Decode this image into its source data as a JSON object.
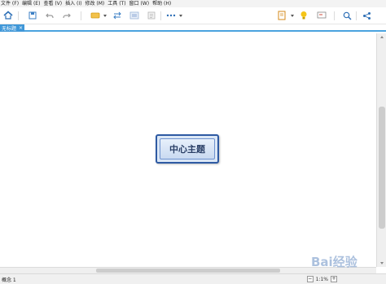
{
  "menu": [
    "文件 (F)",
    "编辑 (E)",
    "查看 (V)",
    "插入 (I)",
    "修改 (M)",
    "工具 (T)",
    "窗口 (W)",
    "帮助 (H)"
  ],
  "tab": {
    "label": "无标题",
    "close": "×"
  },
  "topic": {
    "label": "中心主题"
  },
  "status": {
    "label": "概念 1",
    "zoom": "1:1%",
    "zoom_out": "−",
    "zoom_in": "+"
  },
  "watermark": {
    "text": "Bai经验"
  },
  "colors": {
    "accent": "#3f97d8",
    "topic_border": "#2e5aa3",
    "topic_fill": "#dbe7f6"
  },
  "toolbar_icons": [
    "home-icon",
    "save-icon",
    "undo-icon",
    "redo-icon",
    "topic-icon",
    "relationship-icon",
    "floating-topic-icon",
    "note-icon",
    "more-icon",
    "filter-icon",
    "bulb-icon",
    "presentation-icon",
    "search-icon",
    "share-icon"
  ]
}
